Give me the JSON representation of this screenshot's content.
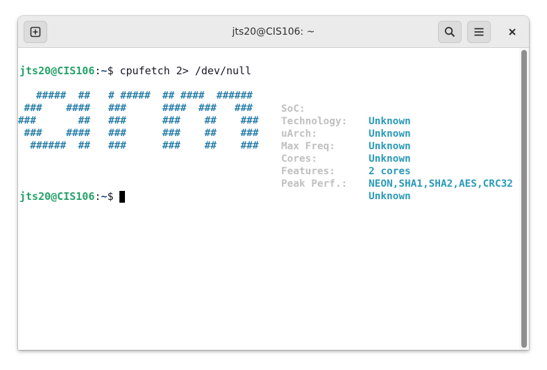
{
  "window": {
    "title": "jts20@CIS106: ~"
  },
  "header_buttons": {
    "new_tab_icon": "new-tab-icon",
    "search_icon": "search-icon",
    "menu_icon": "hamburger-menu-icon",
    "close_icon": "close-icon"
  },
  "terminal": {
    "prompt1": {
      "user": "jts20@CIS106",
      "sep": ":",
      "path": "~",
      "symbol": "$ ",
      "command": "cpufetch 2> /dev/null"
    },
    "ascii_art": [
      "",
      "   #####  ##   # #####  ## ####  ######",
      " ###    ####   ###      ####  ###   ###",
      "###       ##   ###      ###    ##    ###",
      " ###    ####   ###      ###    ##    ###",
      "  ######  ##   ###      ###    ##    ###",
      ""
    ],
    "info": [
      {
        "label": "SoC:",
        "value": "Unknown"
      },
      {
        "label": "Technology:",
        "value": "Unknown"
      },
      {
        "label": "uArch:",
        "value": "Unknown"
      },
      {
        "label": "Max Freq:",
        "value": "Unknown"
      },
      {
        "label": "Cores:",
        "value": "2 cores"
      },
      {
        "label": "Features:",
        "value": "NEON,SHA1,SHA2,AES,CRC32"
      },
      {
        "label": "Peak Perf.:",
        "value": "Unknown"
      }
    ],
    "prompt2": {
      "user": "jts20@CIS106",
      "sep": ":",
      "path": "~",
      "symbol": "$ "
    }
  },
  "colors": {
    "prompt_user": "#26a269",
    "prompt_path": "#12488b",
    "ascii_art": "#2a7fa8",
    "info_label": "#c0c0c0",
    "info_value": "#2a9ab8"
  }
}
